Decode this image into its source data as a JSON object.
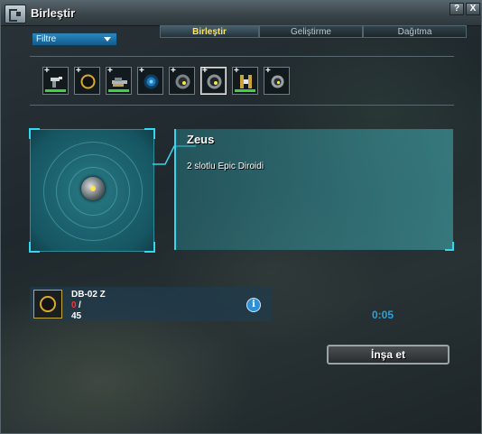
{
  "window": {
    "title": "Birleştir",
    "help_label": "?",
    "close_label": "X"
  },
  "filter": {
    "label": "Filtre"
  },
  "tabs": [
    {
      "label": "Birleştir",
      "active": true
    },
    {
      "label": "Geliştirme",
      "active": false
    },
    {
      "label": "Dağıtma",
      "active": false
    }
  ],
  "items": [
    {
      "icon": "laser-gun-icon",
      "plus": "+"
    },
    {
      "icon": "gold-ring-icon",
      "plus": "+"
    },
    {
      "icon": "cannon-icon",
      "plus": "+"
    },
    {
      "icon": "blue-generator-icon",
      "plus": "+"
    },
    {
      "icon": "drone-icon",
      "plus": "+"
    },
    {
      "icon": "drone-icon",
      "plus": "+",
      "selected": true
    },
    {
      "icon": "gold-cell-icon",
      "plus": "+"
    },
    {
      "icon": "drone-small-icon",
      "plus": "+"
    }
  ],
  "selected_item": {
    "name": "Zeus",
    "description": "2 slotlu Epic Diroidi"
  },
  "requirement": {
    "name": "DB-02 Z",
    "have": "0",
    "slash": "/",
    "need": "45",
    "info_label": "i"
  },
  "timer": "0:05",
  "build_button": {
    "label": "İnşa et"
  },
  "colors": {
    "accent": "#35d6ef",
    "tab_active_text": "#ffe566",
    "timer": "#2f9fd6",
    "missing": "#ff3030"
  }
}
